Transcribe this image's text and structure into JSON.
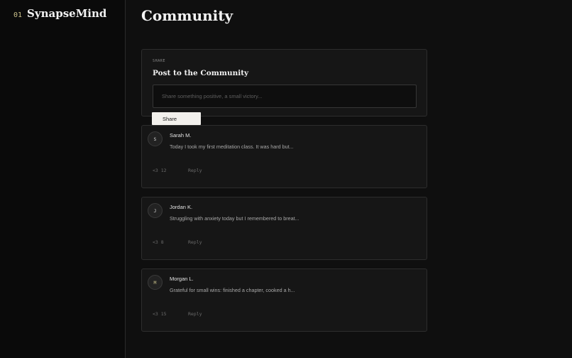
{
  "sidebar": {
    "brand_number": "01",
    "brand_name": "SynapseMind"
  },
  "main": {
    "page_title": "Community"
  },
  "composer": {
    "eyebrow": "SHARE",
    "title": "Post to the Community",
    "placeholder": "Share something positive, a small victory...",
    "value": "",
    "share_label": "Share"
  },
  "posts": [
    {
      "initial": "S",
      "author": "Sarah M.",
      "text": "Today I took my first meditation class. It was hard but...",
      "likes": "<3 12",
      "reply_label": "Reply"
    },
    {
      "initial": "J",
      "author": "Jordan K.",
      "text": "Struggling with anxiety today but I remembered to breat...",
      "likes": "<3 8",
      "reply_label": "Reply"
    },
    {
      "initial": "M",
      "author": "Morgan L.",
      "text": "Grateful for small wins: finished a chapter, cooked a h...",
      "likes": "<3 15",
      "reply_label": "Reply"
    }
  ],
  "colors": {
    "background": "#0f0f0f",
    "sidebar": "#0a0a0a",
    "card": "#161616",
    "accent": "#c9c08a",
    "button": "#f2f0ec"
  }
}
